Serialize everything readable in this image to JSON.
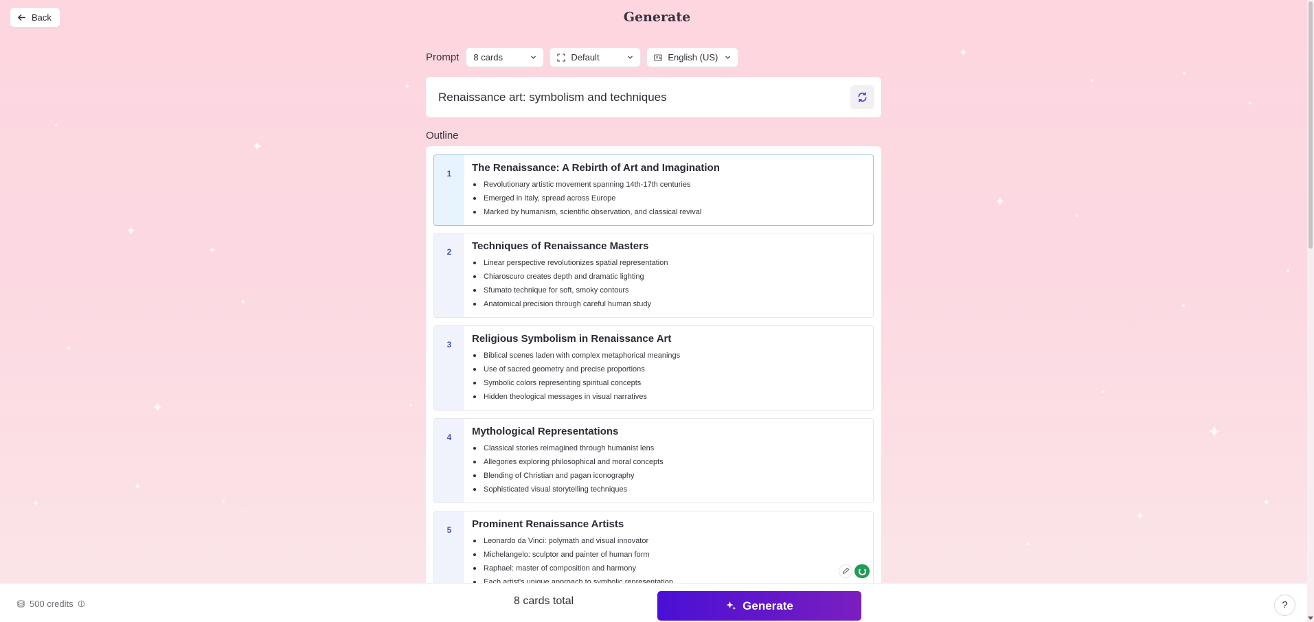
{
  "header": {
    "back_label": "Back",
    "title": "Generate"
  },
  "settings": {
    "prompt_label": "Prompt",
    "cards_option": "8 cards",
    "theme_option": "Default",
    "language_option": "English (US)"
  },
  "prompt": {
    "value": "Renaissance art: symbolism and techniques"
  },
  "outline": {
    "label": "Outline",
    "cards": [
      {
        "number": "1",
        "title": "The Renaissance: A Rebirth of Art and Imagination",
        "bullets": [
          "Revolutionary artistic movement spanning 14th-17th centuries",
          "Emerged in Italy, spread across Europe",
          "Marked by humanism, scientific observation, and classical revival"
        ]
      },
      {
        "number": "2",
        "title": "Techniques of Renaissance Masters",
        "bullets": [
          "Linear perspective revolutionizes spatial representation",
          "Chiaroscuro creates depth and dramatic lighting",
          "Sfumato technique for soft, smoky contours",
          "Anatomical precision through careful human study"
        ]
      },
      {
        "number": "3",
        "title": "Religious Symbolism in Renaissance Art",
        "bullets": [
          "Biblical scenes laden with complex metaphorical meanings",
          "Use of sacred geometry and precise proportions",
          "Symbolic colors representing spiritual concepts",
          "Hidden theological messages in visual narratives"
        ]
      },
      {
        "number": "4",
        "title": "Mythological Representations",
        "bullets": [
          "Classical stories reimagined through humanist lens",
          "Allegories exploring philosophical and moral concepts",
          "Blending of Christian and pagan iconography",
          "Sophisticated visual storytelling techniques"
        ]
      },
      {
        "number": "5",
        "title": "Prominent Renaissance Artists",
        "bullets": [
          "Leonardo da Vinci: polymath and visual innovator",
          "Michelangelo: sculptor and painter of human form",
          "Raphael: master of composition and harmony",
          "Each artist's unique approach to symbolic representation"
        ]
      }
    ]
  },
  "footer": {
    "credits": "500 credits",
    "total": "8 cards total",
    "generate_label": "Generate",
    "help_label": "?"
  },
  "colors": {
    "accent": "#5b14d0",
    "background": "#fcd9e2",
    "card_number": "#4a56a8",
    "active_border": "#9ec1e8"
  },
  "icons": [
    "arrow-left-icon",
    "chevron-down-icon",
    "expand-icon",
    "language-icon",
    "refresh-icon",
    "sparkle-icon",
    "coins-icon",
    "info-icon",
    "pencil-icon",
    "question-icon"
  ]
}
